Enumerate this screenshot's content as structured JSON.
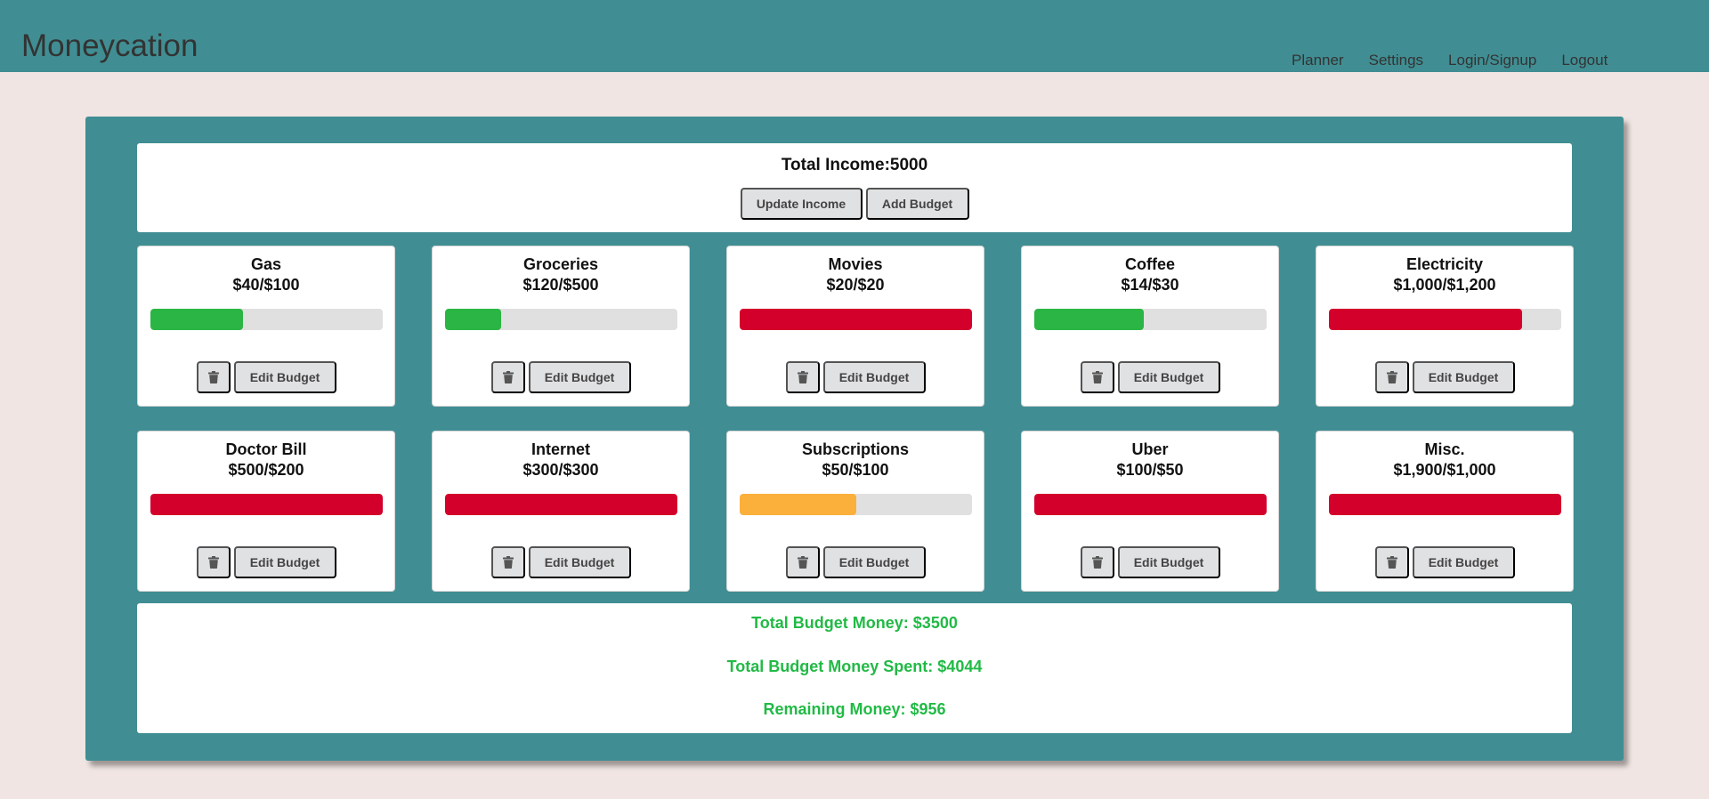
{
  "navbar": {
    "brand": "Moneycation",
    "links": [
      "Planner",
      "Settings",
      "Login/Signup",
      "Logout"
    ]
  },
  "income": {
    "title": "Total Income:5000",
    "update_label": "Update Income",
    "add_label": "Add Budget"
  },
  "budgets": [
    {
      "name": "Gas",
      "amount": "$40/$100",
      "progress": 0.4,
      "status": "ok"
    },
    {
      "name": "Groceries",
      "amount": "$120/$500",
      "progress": 0.24,
      "status": "ok"
    },
    {
      "name": "Movies",
      "amount": "$20/$20",
      "progress": 1.0,
      "status": "over"
    },
    {
      "name": "Coffee",
      "amount": "$14/$30",
      "progress": 0.47,
      "status": "ok"
    },
    {
      "name": "Electricity",
      "amount": "$1,000/$1,200",
      "progress": 0.83,
      "status": "over"
    },
    {
      "name": "Doctor Bill",
      "amount": "$500/$200",
      "progress": 1.0,
      "status": "over"
    },
    {
      "name": "Internet",
      "amount": "$300/$300",
      "progress": 1.0,
      "status": "over"
    },
    {
      "name": "Subscriptions",
      "amount": "$50/$100",
      "progress": 0.5,
      "status": "warn"
    },
    {
      "name": "Uber",
      "amount": "$100/$50",
      "progress": 1.0,
      "status": "over"
    },
    {
      "name": "Misc.",
      "amount": "$1,900/$1,000",
      "progress": 1.0,
      "status": "over"
    }
  ],
  "card_actions": {
    "delete_icon": "trash-icon",
    "edit_label": "Edit Budget"
  },
  "summary": {
    "total_budget": "Total Budget Money: $3500",
    "total_spent": "Total Budget Money Spent: $4044",
    "remaining": "Remaining Money: $956"
  },
  "colors": {
    "primary": "#408e93",
    "background": "#f0e5e2",
    "ok": "#2bb544",
    "warn": "#fbb03b",
    "over": "#d3002c",
    "summary_text": "#21ba45"
  }
}
